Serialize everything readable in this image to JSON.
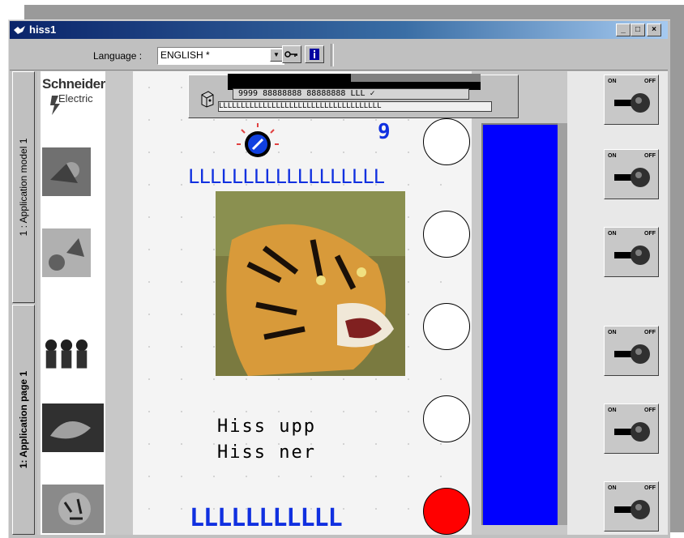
{
  "window": {
    "title": "hiss1"
  },
  "window_buttons": {
    "minimize": "_",
    "maximize": "□",
    "close": "×"
  },
  "toolbar": {
    "language_label": "Language :",
    "language_value": "ENGLISH *",
    "dropdown_arrow": "▼"
  },
  "tabs": [
    {
      "label": "1 : Application model 1"
    },
    {
      "label": "1: Application page 1"
    }
  ],
  "logo": {
    "line1": "Schneider",
    "line2": "Electric"
  },
  "overlay": {
    "digits": "9999  88888888  88888888  LLL  ✓",
    "label_strip": "LLLLLLLLLLLLLLLLLLLLLLLLLLLLLLLLLLLLL"
  },
  "canvas": {
    "number_display": "9",
    "label_row_top": "LLLLLLLLLLLLLLLLLL",
    "label_row_bottom": "LLLLLLLLLLL",
    "text_up": "Hiss upp",
    "text_down": "Hiss ner"
  },
  "toggle": {
    "on": "ON",
    "off": "OFF"
  },
  "colors": {
    "accent_blue": "#0000ff",
    "text_blue": "#1030e0",
    "indicator_red": "#ff0000"
  },
  "indicators": [
    {
      "state": "off"
    },
    {
      "state": "off"
    },
    {
      "state": "off"
    },
    {
      "state": "off"
    },
    {
      "state": "on"
    }
  ]
}
